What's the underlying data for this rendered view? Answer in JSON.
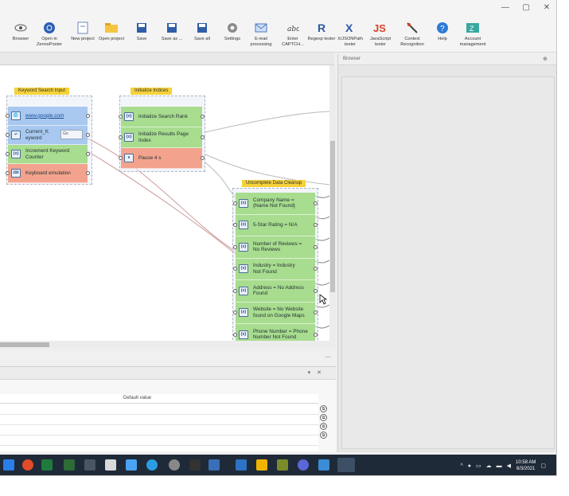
{
  "window": {
    "controls": [
      "—",
      "▢",
      "✕"
    ]
  },
  "toolbar": {
    "items": [
      {
        "label": "Browser",
        "icon": "eye-icon"
      },
      {
        "label": "Open in\nZennoPoster",
        "icon": "zennoposter-icon"
      },
      {
        "label": "New project",
        "icon": "new-project-icon"
      },
      {
        "label": "Open project",
        "icon": "folder-icon"
      },
      {
        "label": "Save",
        "icon": "save-icon"
      },
      {
        "label": "Save as ...",
        "icon": "save-as-icon"
      },
      {
        "label": "Save all",
        "icon": "save-all-icon"
      },
      {
        "label": "Settings",
        "icon": "gear-icon"
      },
      {
        "label": "E-mail\nprocessing",
        "icon": "email-icon"
      },
      {
        "label": "Enter\nCAPTCH...",
        "icon": "captcha-icon"
      },
      {
        "label": "Regexp tester",
        "icon": "regexp-icon"
      },
      {
        "label": "X/JSONPath\ntester",
        "icon": "xpath-icon"
      },
      {
        "label": "JavaScript\ntester",
        "icon": "javascript-icon"
      },
      {
        "label": "Context\nRecognition",
        "icon": "context-recognition-icon"
      },
      {
        "label": "Help",
        "icon": "help-icon"
      },
      {
        "label": "Account\nmanagement",
        "icon": "account-icon"
      }
    ]
  },
  "canvas": {
    "groups": {
      "keyword": {
        "title": "Keyword Search Input",
        "nodes": [
          {
            "text": "www.google.com",
            "color": "blue",
            "icon": "globe-icon"
          },
          {
            "text": "Current_K\neyword",
            "color": "blue",
            "icon": "keyboard-input-icon",
            "field": "Go"
          },
          {
            "text": "Increment Keyword\nCounter",
            "color": "green",
            "icon": "variable-icon"
          },
          {
            "text": "Keyboard emulation",
            "color": "red",
            "icon": "keyboard-icon"
          }
        ]
      },
      "initialize": {
        "title": "Initialize Indices",
        "nodes": [
          {
            "text": "Initialize Search Rank",
            "color": "green",
            "icon": "variable-icon"
          },
          {
            "text": "Initialize Results Page\nIndex",
            "color": "green",
            "icon": "variable-icon"
          },
          {
            "text": "Pause 4 s",
            "color": "red",
            "icon": "pause-icon"
          }
        ]
      },
      "cleanup": {
        "title": "Uncomplete Data Cleanup",
        "nodes": [
          {
            "text": "Company Name = \n{Name Not Found}",
            "icon": "variable-icon"
          },
          {
            "text": "5-Star Rating = N/A",
            "icon": "variable-icon"
          },
          {
            "text": "Number of Reviews = \nNo Reviews",
            "icon": "variable-icon"
          },
          {
            "text": "Industry = Industry\nNot Found",
            "icon": "variable-icon"
          },
          {
            "text": "Address = No Address\nFound",
            "icon": "variable-icon"
          },
          {
            "text": "Website = No Website\nfound on Google Maps",
            "icon": "variable-icon"
          },
          {
            "text": "Phone Number = Phone\nNumber Not Found",
            "icon": "variable-icon"
          }
        ]
      }
    }
  },
  "browser_panel": {
    "title": "Browser"
  },
  "bottom_panel": {
    "column_header": "Default value"
  },
  "taskbar": {
    "clock_time": "10:58 AM",
    "clock_date": "6/3/2021"
  },
  "colors": {
    "node_blue": "#a9c8ef",
    "node_green": "#a8dc8f",
    "node_red": "#f3a38d",
    "group_title": "#f6d23a",
    "taskbar": "#1f2a38"
  }
}
